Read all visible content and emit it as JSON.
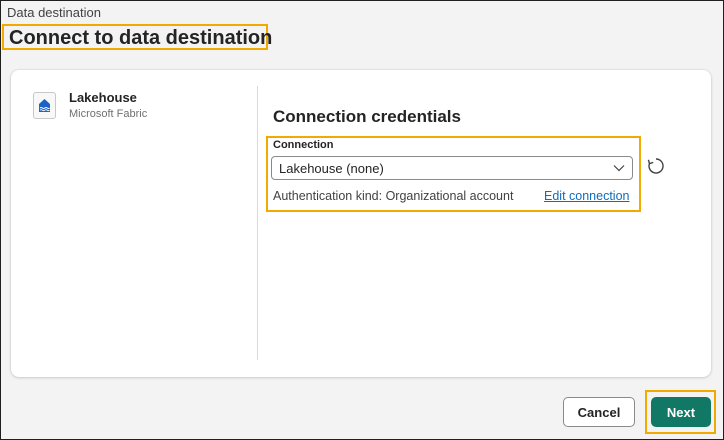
{
  "header": {
    "breadcrumb": "Data destination",
    "title": "Connect to data destination"
  },
  "destination": {
    "name": "Lakehouse",
    "subtitle": "Microsoft Fabric",
    "icon": "lakehouse-icon"
  },
  "credentials": {
    "title": "Connection credentials",
    "connection_label": "Connection",
    "connection_value": "Lakehouse (none)",
    "auth_text": "Authentication kind: Organizational account",
    "edit_link": "Edit connection"
  },
  "footer": {
    "cancel_label": "Cancel",
    "next_label": "Next"
  },
  "colors": {
    "accent": "#117865",
    "highlight": "#f2a900",
    "link": "#0f6cbd"
  }
}
